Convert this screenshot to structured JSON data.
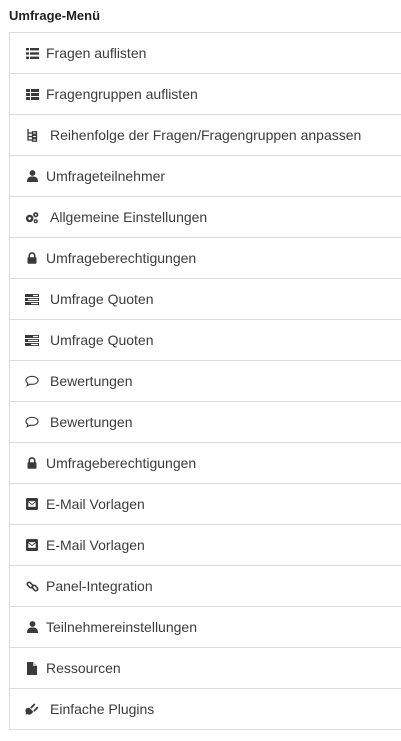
{
  "menu": {
    "title": "Umfrage-Menü",
    "items": [
      {
        "label": "Fragen auflisten",
        "icon": "list-icon"
      },
      {
        "label": "Fragengruppen auflisten",
        "icon": "grouped-list-icon"
      },
      {
        "label": "Reihenfolge der Fragen/Fragengruppen anpassen",
        "icon": "sort-tree-icon"
      },
      {
        "label": "Umfrageteilnehmer",
        "icon": "user-icon"
      },
      {
        "label": "Allgemeine Einstellungen",
        "icon": "gears-icon"
      },
      {
        "label": "Umfrageberechtigungen",
        "icon": "lock-icon"
      },
      {
        "label": "Umfrage Quoten",
        "icon": "tasks-icon"
      },
      {
        "label": "Umfrage Quoten",
        "icon": "tasks-icon"
      },
      {
        "label": "Bewertungen",
        "icon": "comment-icon"
      },
      {
        "label": "Bewertungen",
        "icon": "comment-icon"
      },
      {
        "label": "Umfrageberechtigungen",
        "icon": "lock-icon"
      },
      {
        "label": "E-Mail Vorlagen",
        "icon": "envelope-square-icon"
      },
      {
        "label": "E-Mail Vorlagen",
        "icon": "envelope-square-icon"
      },
      {
        "label": "Panel-Integration",
        "icon": "link-icon"
      },
      {
        "label": "Teilnehmereinstellungen",
        "icon": "user-icon"
      },
      {
        "label": "Ressourcen",
        "icon": "file-icon"
      },
      {
        "label": "Einfache Plugins",
        "icon": "plug-icon"
      }
    ]
  }
}
